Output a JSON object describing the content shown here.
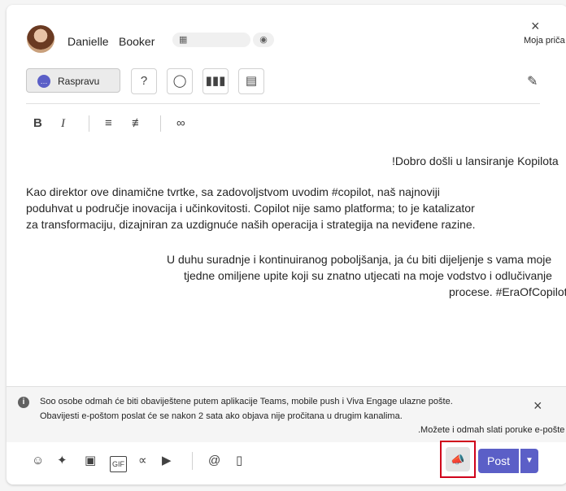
{
  "author": {
    "first_name": "Danielle",
    "last_name": "Booker"
  },
  "header": {
    "close_label": "×",
    "moja_label": "Moja priča"
  },
  "post_type": {
    "selected_label": "Raspravu",
    "options_icons": [
      "question-icon",
      "praise-icon",
      "poll-icon",
      "article-icon"
    ]
  },
  "editor": {
    "paragraphs": [
      {
        "lines": [
          "!Dobro došli u lansiranje Kopilota"
        ]
      },
      {
        "lines": [
          "Kao direktor ove dinamične tvrtke, sa zadovoljstvom uvodim #copilot, naš najnoviji",
          "poduhvat u područje inovacija i učinkovitosti. Copilot nije samo platforma; to je katalizator",
          "za transformaciju, dizajniran za uzdignuće naših operacija i strategija na neviđene razine."
        ]
      },
      {
        "lines": [
          "U duhu suradnje i kontinuiranog poboljšanja, ja ću biti dijeljenje s vama moje",
          "tjedne omiljene upite koji su znatno utjecati na moje vodstvo i odlučivanje",
          "procese. #EraOfCopilot"
        ]
      }
    ]
  },
  "notice": {
    "line1": "Soo osobe odmah će biti obavije­štene putem aplikacije Teams, mobile push i Viva Engage ulazne pošte.",
    "line2": "Obavijesti e-poštom poslat će se nakon 2 sata ako objava nije pročitana u drugim kanalima.",
    "line3": ".Možete i odmah slati poruke e-pošte"
  },
  "footer": {
    "post_label": "Post"
  },
  "colors": {
    "accent": "#5b5fc7",
    "highlight_border": "#d0021b"
  }
}
